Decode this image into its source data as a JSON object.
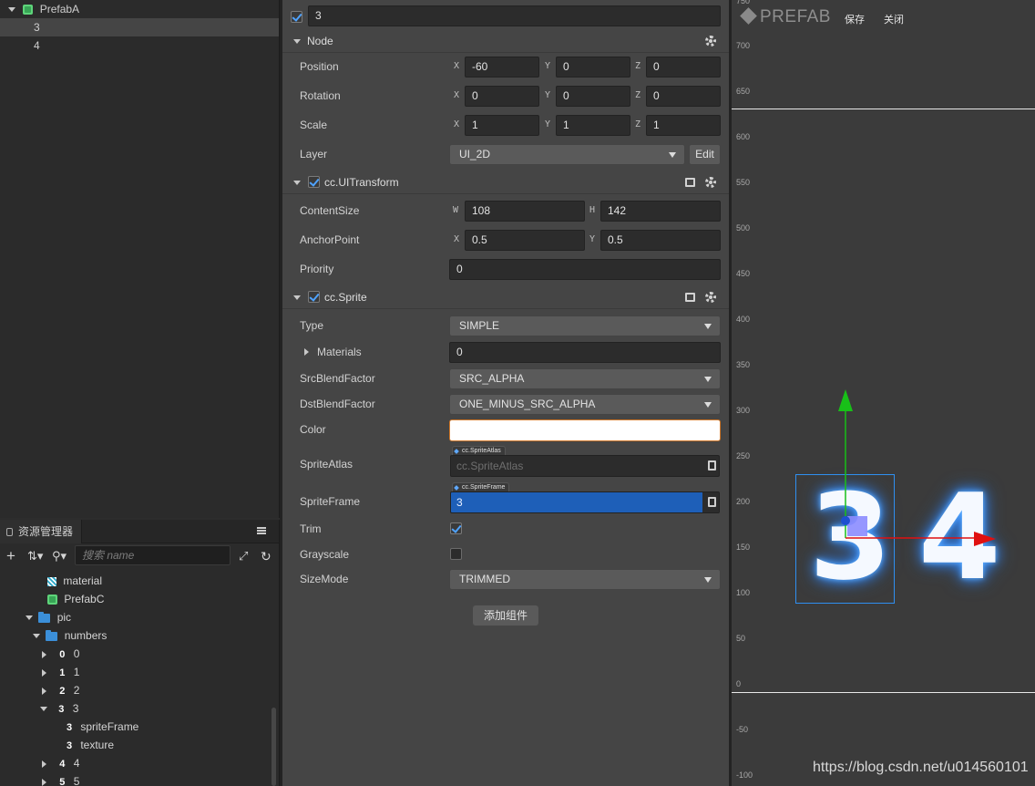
{
  "hierarchy": {
    "root": "PrefabA",
    "children": [
      "3",
      "4"
    ],
    "selected": "3"
  },
  "assets": {
    "tab_label": "资源管理器",
    "search_placeholder": "搜索 name",
    "items": [
      {
        "label": "material",
        "icon": "material-icon"
      },
      {
        "label": "PrefabC",
        "icon": "prefab-icon"
      },
      {
        "label": "pic",
        "icon": "folder-icon"
      },
      {
        "label": "numbers",
        "icon": "folder-icon"
      },
      {
        "label": "0",
        "glyph": "0"
      },
      {
        "label": "1",
        "glyph": "1"
      },
      {
        "label": "2",
        "glyph": "2"
      },
      {
        "label": "3",
        "glyph": "3"
      },
      {
        "label": "spriteFrame",
        "glyph": "3"
      },
      {
        "label": "texture",
        "glyph": "3"
      },
      {
        "label": "4",
        "glyph": "4"
      },
      {
        "label": "5",
        "glyph": "5"
      }
    ]
  },
  "inspector": {
    "node_name": "3",
    "node_section": "Node",
    "position": {
      "label": "Position",
      "x": "-60",
      "y": "0",
      "z": "0"
    },
    "rotation": {
      "label": "Rotation",
      "x": "0",
      "y": "0",
      "z": "0"
    },
    "scale": {
      "label": "Scale",
      "x": "1",
      "y": "1",
      "z": "1"
    },
    "layer": {
      "label": "Layer",
      "value": "UI_2D",
      "edit": "Edit"
    },
    "uitransform": {
      "title": "cc.UITransform",
      "content_size": {
        "label": "ContentSize",
        "w": "108",
        "h": "142"
      },
      "anchor": {
        "label": "AnchorPoint",
        "x": "0.5",
        "y": "0.5"
      },
      "priority": {
        "label": "Priority",
        "value": "0"
      }
    },
    "sprite": {
      "title": "cc.Sprite",
      "type": {
        "label": "Type",
        "value": "SIMPLE"
      },
      "materials": {
        "label": "Materials",
        "value": "0"
      },
      "src_blend": {
        "label": "SrcBlendFactor",
        "value": "SRC_ALPHA"
      },
      "dst_blend": {
        "label": "DstBlendFactor",
        "value": "ONE_MINUS_SRC_ALPHA"
      },
      "color": {
        "label": "Color",
        "value": "#ffffff"
      },
      "sprite_atlas": {
        "label": "SpriteAtlas",
        "tag": "cc.SpriteAtlas",
        "value": "cc.SpriteAtlas"
      },
      "sprite_frame": {
        "label": "SpriteFrame",
        "tag": "cc.SpriteFrame",
        "value": "3"
      },
      "trim": {
        "label": "Trim",
        "checked": true
      },
      "grayscale": {
        "label": "Grayscale",
        "checked": false
      },
      "size_mode": {
        "label": "SizeMode",
        "value": "TRIMMED"
      }
    },
    "axis_x": "X",
    "axis_y": "Y",
    "axis_z": "Z",
    "axis_w": "W",
    "axis_h": "H",
    "add_component": "添加组件"
  },
  "scene": {
    "prefab_label": "PREFAB",
    "save": "保存",
    "close": "关闭",
    "ruler": [
      "750",
      "700",
      "650",
      "600",
      "550",
      "500",
      "450",
      "400",
      "350",
      "300",
      "250",
      "200",
      "150",
      "100",
      "50",
      "0",
      "-50",
      "-100"
    ],
    "digit_a": "3",
    "digit_b": "4"
  },
  "watermark": "https://blog.csdn.net/u014560101",
  "colors": {
    "accent": "#1e5fb8",
    "gizmo_x": "#e01010",
    "gizmo_y": "#18c018"
  }
}
